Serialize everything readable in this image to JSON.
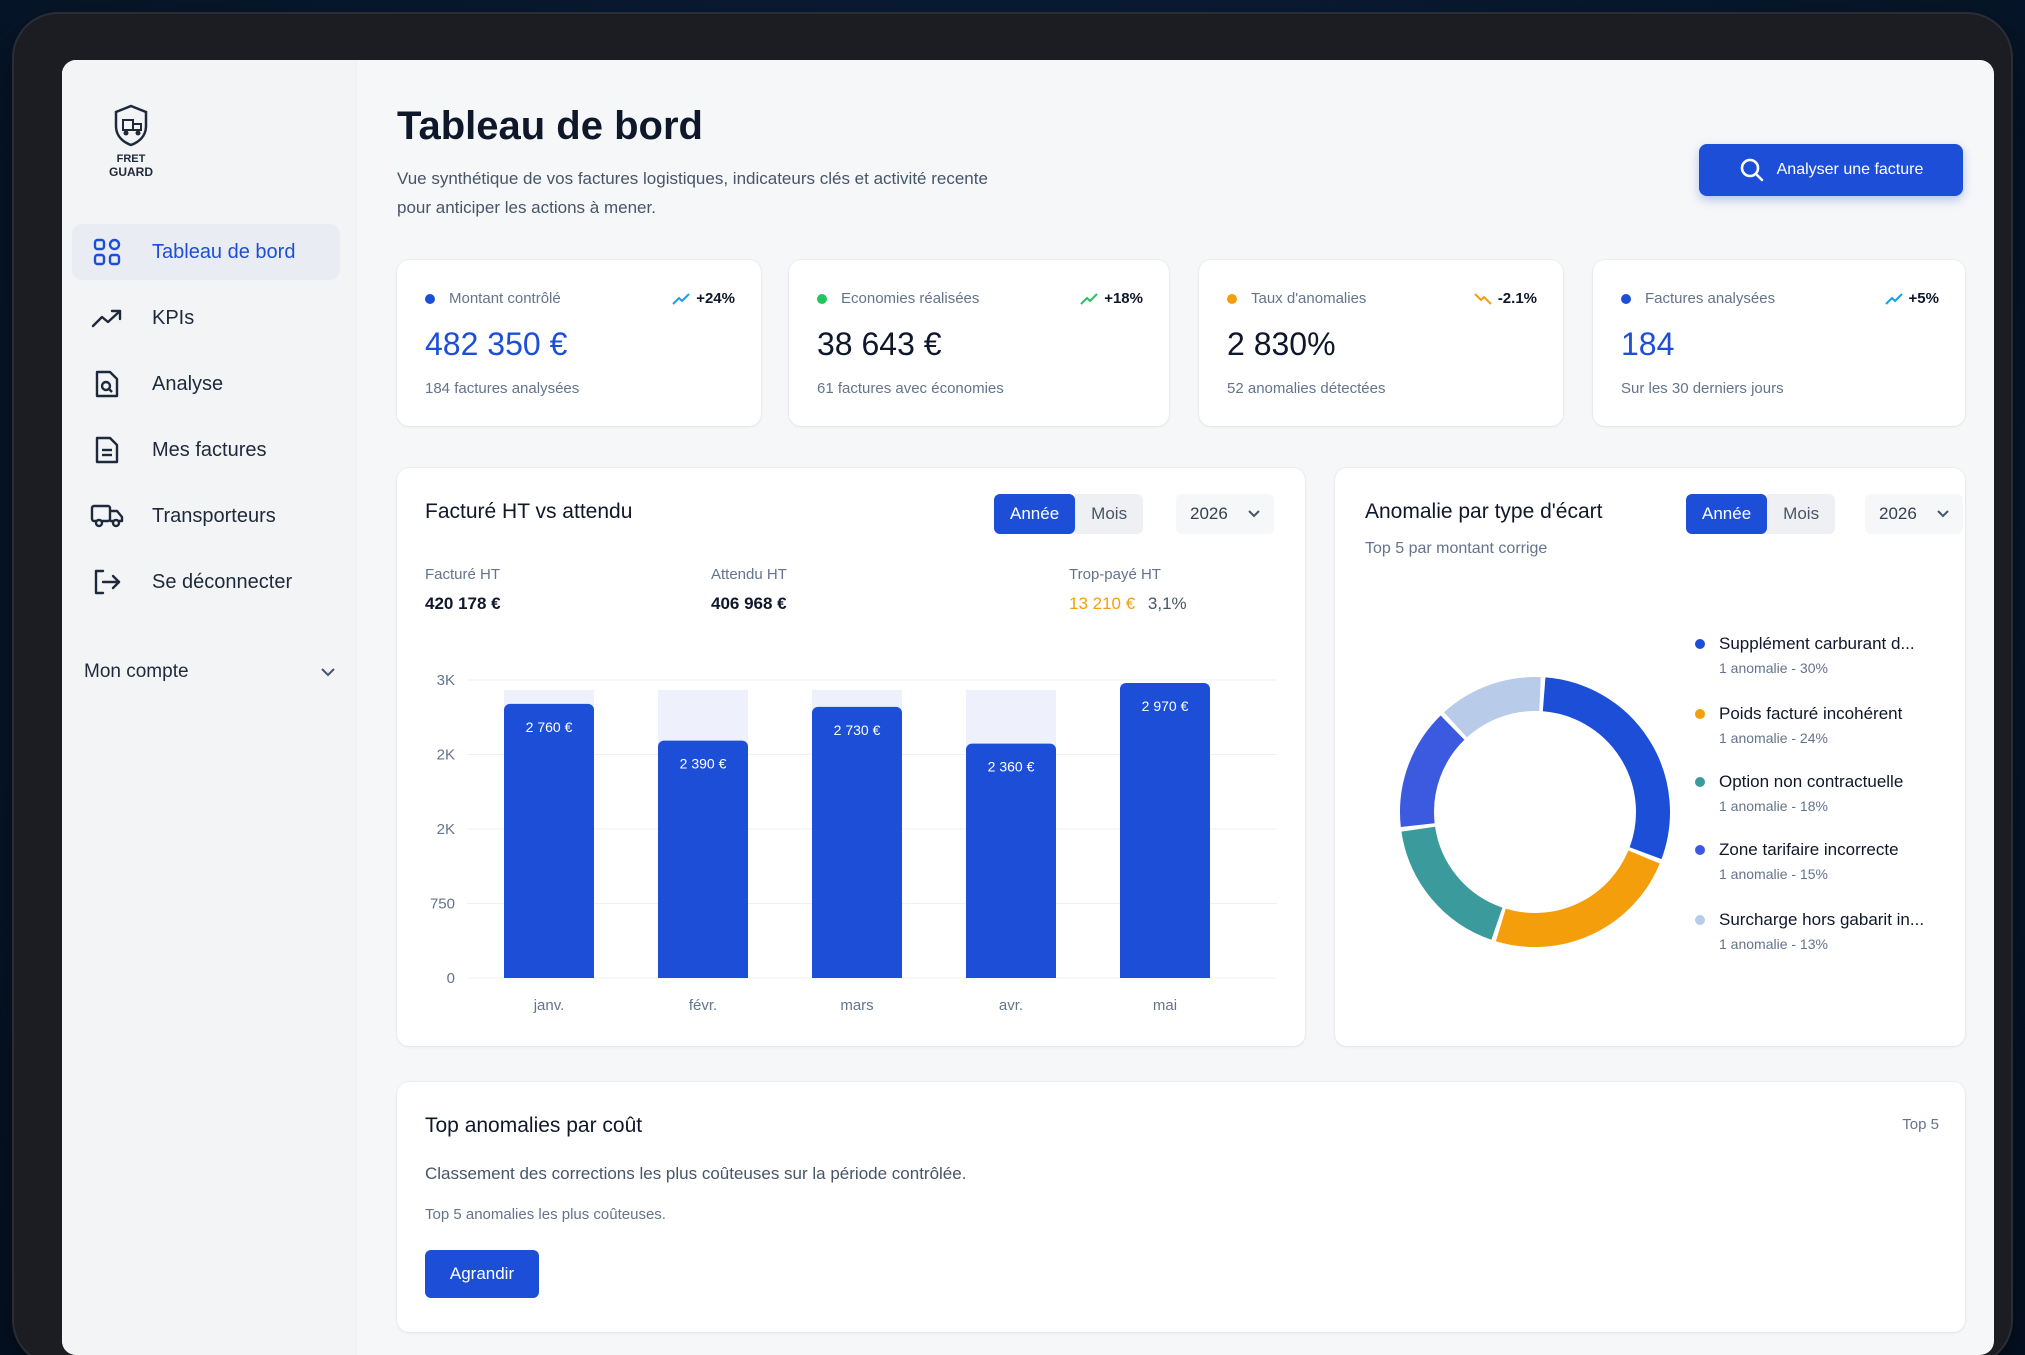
{
  "brand": {
    "logo_text": [
      "FRET",
      "GUARD"
    ]
  },
  "sidebar": {
    "items": [
      {
        "label": "Tableau de bord",
        "icon": "grid-icon",
        "active": true
      },
      {
        "label": "KPIs",
        "icon": "trending-up-icon",
        "active": false
      },
      {
        "label": "Analyse",
        "icon": "search-document-icon",
        "active": false
      },
      {
        "label": "Mes factures",
        "icon": "file-icon",
        "active": false
      },
      {
        "label": "Transporteurs",
        "icon": "truck-icon",
        "active": false
      },
      {
        "label": "Se déconnecter",
        "icon": "logout-icon",
        "active": false
      }
    ],
    "account_label": "Mon compte"
  },
  "header": {
    "title": "Tableau de bord",
    "subtitle": "Vue synthétique de vos factures logistiques, indicateurs clés et activité recente pour anticiper les actions à mener.",
    "analyze_button": "Analyser une facture"
  },
  "kpis": [
    {
      "label": "Montant contrôlé",
      "trend": "+24%",
      "value": "482 350 €",
      "note": "184 factures analysées",
      "dot_color": "#1d4ed8",
      "value_color": "#1d4ed8",
      "trend_color": "#0ea5e9"
    },
    {
      "label": "Economies réalisées",
      "trend": "+18%",
      "value": "38 643 €",
      "note": "61 factures avec économies",
      "dot_color": "#22c55e",
      "value_color": "#0f172a",
      "trend_color": "#22c55e"
    },
    {
      "label": "Taux d'anomalies",
      "trend": "-2.1%",
      "value": "2 830%",
      "note": "52 anomalies détectées",
      "dot_color": "#f59e0b",
      "value_color": "#0f172a",
      "trend_color": "#f59e0b"
    },
    {
      "label": "Factures analysées",
      "trend": "+5%",
      "value": "184",
      "note": "Sur les 30 derniers jours",
      "dot_color": "#1d4ed8",
      "value_color": "#1d4ed8",
      "trend_color": "#0ea5e9"
    }
  ],
  "bar_panel": {
    "title": "Facturé HT vs attendu",
    "toggle_on": "Année",
    "toggle_off": "Mois",
    "year": "2026",
    "stats": {
      "billed_label": "Facturé HT",
      "billed_value": "420 178 €",
      "expected_label": "Attendu HT",
      "expected_value": "406 968 €",
      "overpaid_label": "Trop-payé HT",
      "overpaid_value": "13 210 €",
      "overpaid_pct": "3,1%"
    }
  },
  "donut_panel": {
    "title": "Anomalie par type d'écart",
    "subtitle": "Top 5 par montant corrige",
    "toggle_on": "Année",
    "toggle_off": "Mois",
    "year": "2026"
  },
  "bottom_panel": {
    "title": "Top anomalies par coût",
    "badge": "Top 5",
    "description": "Classement des corrections les plus coûteuses sur la période contrôlée.",
    "note": "Top 5 anomalies les plus coûteuses.",
    "button": "Agrandir"
  },
  "chart_data": [
    {
      "type": "bar",
      "title": "Facturé HT vs attendu",
      "categories": [
        "janv.",
        "févr.",
        "mars",
        "avr.",
        "mai"
      ],
      "series": [
        {
          "values": [
            2760,
            2390,
            2730,
            2360,
            2970
          ],
          "labels": [
            "2 760 €",
            "2 390 €",
            "2 730 €",
            "2 360 €",
            "2 970 €"
          ],
          "color": "#1d4ed8"
        },
        {
          "values": [
            2900,
            2900,
            2900,
            2900,
            2900
          ],
          "color": "#eef1fb"
        }
      ],
      "ytick_labels": [
        "0",
        "750",
        "2K",
        "2K",
        "3K"
      ],
      "ylim": [
        0,
        3000
      ]
    },
    {
      "type": "pie",
      "title": "Anomalie par type d'écart",
      "slices": [
        {
          "label": "Supplément carburant d...",
          "sub": "1 anomalie - 30%",
          "value": 30,
          "color": "#1d4ed8"
        },
        {
          "label": "Poids facturé incohérent",
          "sub": "1 anomalie - 24%",
          "value": 24,
          "color": "#f59e0b"
        },
        {
          "label": "Option non contractuelle",
          "sub": "1 anomalie - 18%",
          "value": 18,
          "color": "#3b9a9c"
        },
        {
          "label": "Zone tarifaire incorrecte",
          "sub": "1 anomalie - 15%",
          "value": 15,
          "color": "#3b5ae0"
        },
        {
          "label": "Surcharge hors gabarit in...",
          "sub": "1 anomalie - 13%",
          "value": 13,
          "color": "#b8cbe8"
        }
      ]
    }
  ]
}
